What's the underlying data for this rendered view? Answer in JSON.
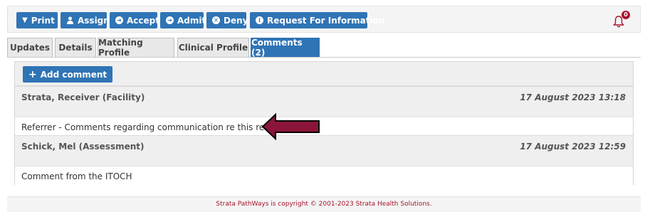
{
  "toolbar": {
    "print": "Print",
    "assign": "Assign",
    "accept": "Accept",
    "admit": "Admit",
    "deny": "Deny",
    "request_info": "Request For Information",
    "notification_count": "0"
  },
  "tabs": [
    {
      "label": "Updates",
      "active": false
    },
    {
      "label": "Details",
      "active": false
    },
    {
      "label": "Matching Profile",
      "active": false
    },
    {
      "label": "Clinical Profile",
      "active": false
    },
    {
      "label": "Comments (2)",
      "active": true
    }
  ],
  "comments_panel": {
    "add_label": "Add comment",
    "items": [
      {
        "author": "Strata, Receiver (Facility)",
        "date": "17 August 2023 13:18",
        "text": "Referrer - Comments regarding communication re this referral."
      },
      {
        "author": "Schick, Mel (Assessment)",
        "date": "17 August 2023 12:59",
        "text": "Comment from the ITOCH"
      }
    ]
  },
  "annotation_arrow_color": "#8b1538",
  "accent_color": "#2f74b5",
  "footer": {
    "text": "Strata PathWays is copyright © 2001-2023 Strata Health Solutions."
  }
}
